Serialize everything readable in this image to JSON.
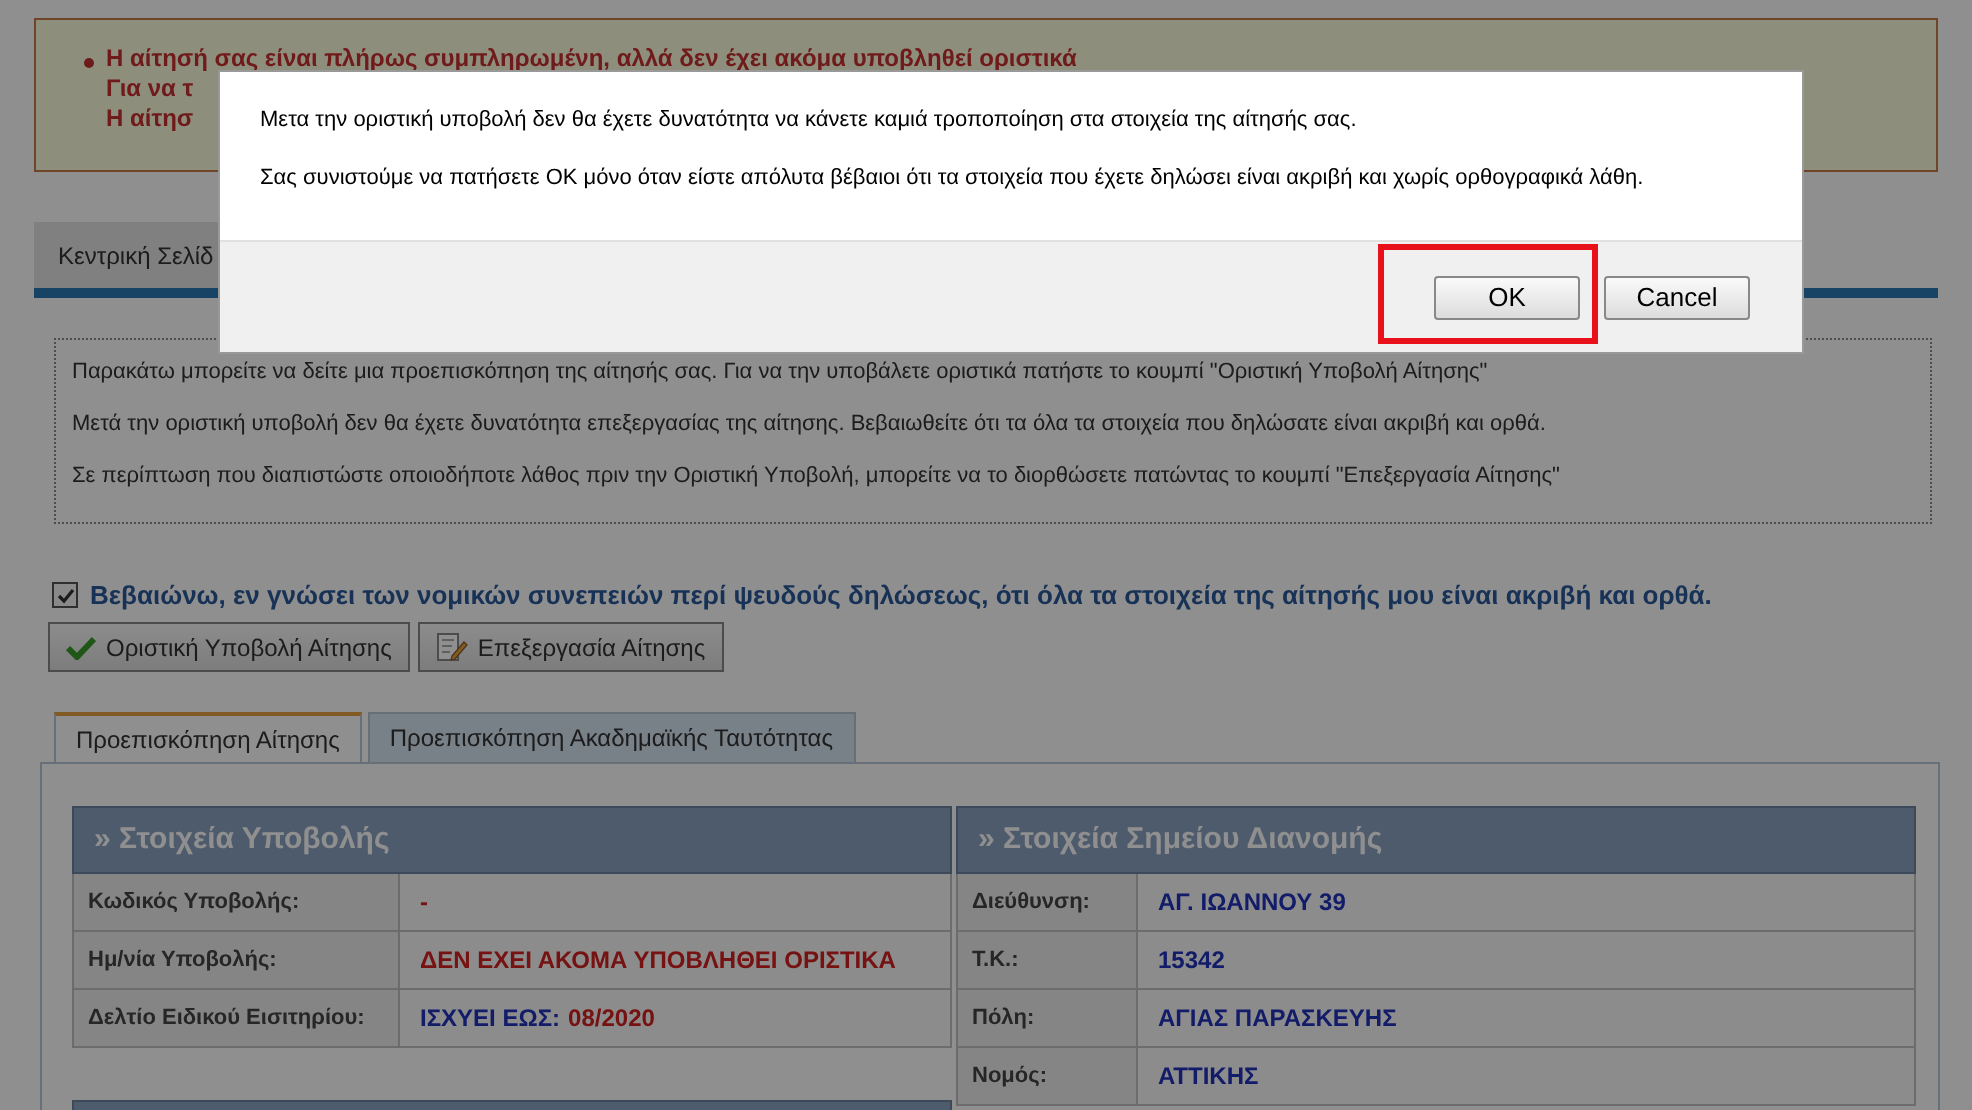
{
  "alert": {
    "lines": [
      "Η αίτησή σας είναι πλήρως συμπληρωμένη, αλλά δεν έχει ακόμα υποβληθεί οριστικά",
      "Για να τ",
      "Η αίτησ"
    ]
  },
  "nav_tabs": [
    {
      "label": "Κεντρική Σελίδ"
    }
  ],
  "info_box": {
    "paragraphs": [
      "Παρακάτω μπορείτε να δείτε μια προεπισκόπηση της αίτησής σας. Για να την υποβάλετε οριστικά πατήστε το κουμπί \"Οριστική Υποβολή Αίτησης\"",
      "Μετά την οριστική υποβολή δεν θα έχετε δυνατότητα επεξεργασίας της αίτησης. Βεβαιωθείτε ότι τα όλα τα στοιχεία που δηλώσατε είναι ακριβή και ορθά.",
      "Σε περίπτωση που διαπιστώστε οποιοδήποτε λάθος πριν την Οριστική Υποβολή, μπορείτε να το διορθώσετε πατώντας το κουμπί \"Επεξεργασία Αίτησης\""
    ]
  },
  "declaration": {
    "label": "Βεβαιώνω, εν γνώσει των νομικών συνεπειών περί ψευδούς δηλώσεως, ότι όλα τα στοιχεία της αίτησής μου είναι ακριβή και ορθά.",
    "checked": true
  },
  "actions": [
    {
      "label": "Οριστική Υποβολή Αίτησης",
      "kind": "submit"
    },
    {
      "label": "Επεξεργασία Αίτησης",
      "kind": "edit"
    }
  ],
  "preview_tabs": [
    {
      "label": "Προεπισκόπηση Αίτησης",
      "selected": true
    },
    {
      "label": "Προεπισκόπηση Ακαδημαϊκής Ταυτότητας",
      "selected": false
    }
  ],
  "submission_table": {
    "title": "» Στοιχεία Υποβολής",
    "rows": [
      {
        "label": "Κωδικός Υποβολής:",
        "kind": "alert",
        "value": "-"
      },
      {
        "label": "Ημ/νία Υποβολής:",
        "kind": "alert",
        "value": "ΔΕΝ ΕΧΕΙ ΑΚΟΜΑ ΥΠΟΒΛΗΘΕΙ ΟΡΙΣΤΙΚΑ"
      },
      {
        "label": "Δελτίο Ειδικού Εισιτηρίου:",
        "kind": "validity",
        "value": "ΙΣΧΥΕΙ ΕΩΣ:",
        "date": "08/2020"
      }
    ]
  },
  "delivery_table": {
    "title": "» Στοιχεία Σημείου Διανομής",
    "rows": [
      {
        "label": "Διεύθυνση:",
        "kind": "info",
        "value": "ΑΓ. ΙΩΑΝΝΟΥ 39"
      },
      {
        "label": "Τ.Κ.:",
        "kind": "info",
        "value": "15342"
      },
      {
        "label": "Πόλη:",
        "kind": "info",
        "value": "ΑΓΙΑΣ ΠΑΡΑΣΚΕΥΗΣ"
      },
      {
        "label": "Νομός:",
        "kind": "info",
        "value": "ΑΤΤΙΚΗΣ"
      }
    ]
  },
  "dialog": {
    "messages": [
      "Μετα την οριστική υποβολή δεν θα έχετε δυνατότητα να κάνετε καμιά τροποποίηση στα στοιχεία της αίτησής σας.",
      "Σας συνιστούμε να πατήσετε ΟΚ μόνο όταν είστε απόλυτα βέβαιοι ότι τα στοιχεία που έχετε δηλώσει είναι ακριβή και χωρίς ορθογραφικά λάθη."
    ],
    "buttons": [
      {
        "label": "OK",
        "highlighted": true
      },
      {
        "label": "Cancel",
        "highlighted": false
      }
    ]
  }
}
